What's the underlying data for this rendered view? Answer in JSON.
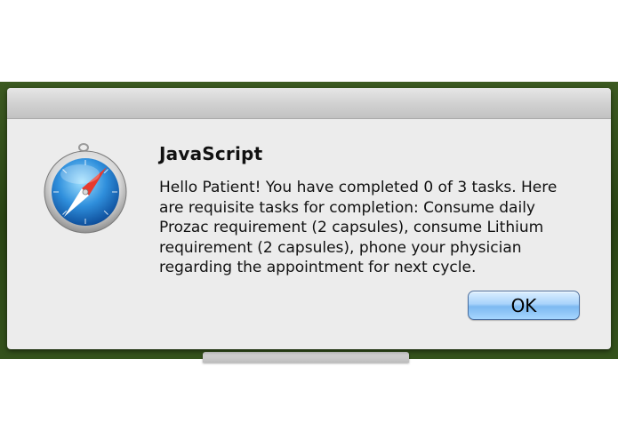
{
  "dialog": {
    "title": "JavaScript",
    "message": "Hello Patient! You have completed 0 of 3 tasks. Here are requisite tasks for completion: Consume daily Prozac requirement (2 capsules), consume Lithium requirement (2 capsules), phone your physician regarding the appointment for next cycle.",
    "ok_label": "OK",
    "icon": "safari-compass-icon"
  },
  "colors": {
    "desktop": "#2e4a17",
    "dialog_background": "#ececec",
    "button_accent": "#7db9f0"
  }
}
